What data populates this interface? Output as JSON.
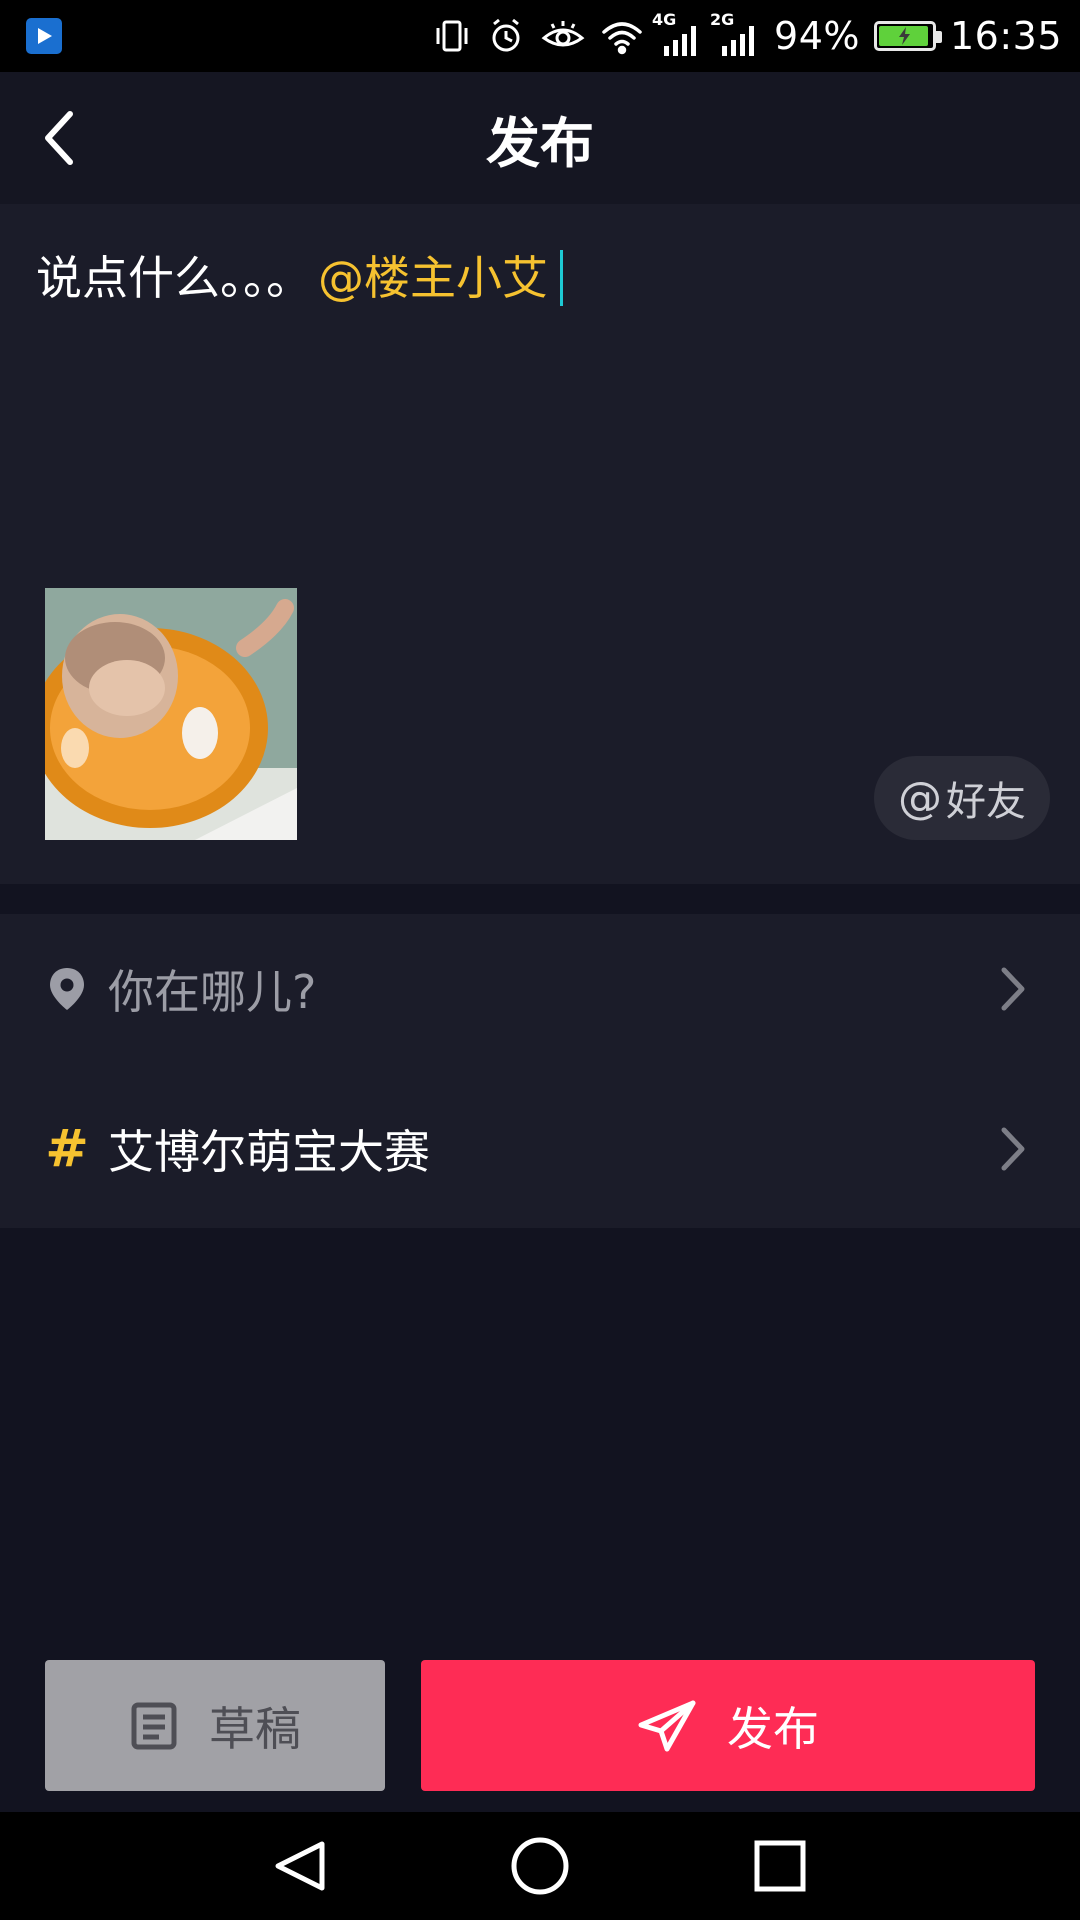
{
  "status_bar": {
    "network_4g": "4G",
    "network_2g": "2G",
    "battery_percent": "94%",
    "battery_level": 0.94,
    "time": "16:35"
  },
  "header": {
    "title": "发布"
  },
  "compose": {
    "caption_text": "说点什么。。。",
    "mention": "@楼主小艾",
    "friend_button_at": "@",
    "friend_button_label": "好友"
  },
  "options": {
    "location_label": "你在哪儿?",
    "topic_label": "艾博尔萌宝大赛",
    "topic_symbol": "#"
  },
  "actions": {
    "draft_label": "草稿",
    "publish_label": "发布"
  },
  "colors": {
    "accent_pink": "#fe2c55",
    "mention_yellow": "#f6c230",
    "cursor_teal": "#1ecad4"
  },
  "icons": {
    "back": "chevron-left-icon",
    "location": "location-pin-icon",
    "topic": "hashtag-icon",
    "draft": "draft-icon",
    "publish": "paper-plane-icon"
  }
}
